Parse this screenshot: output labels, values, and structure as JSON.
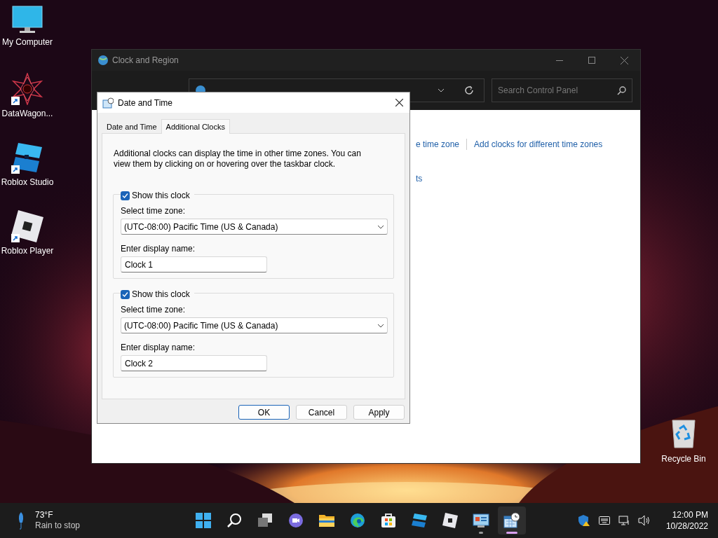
{
  "desktop_icons": [
    {
      "label": "My Computer",
      "kind": "monitor",
      "shortcut": false
    },
    {
      "label": "DataWagon...",
      "kind": "star",
      "shortcut": true
    },
    {
      "label": "Roblox Studio",
      "kind": "studio",
      "shortcut": true
    },
    {
      "label": "Roblox Player",
      "kind": "player",
      "shortcut": true
    }
  ],
  "recycle_bin": {
    "label": "Recycle Bin"
  },
  "control_panel": {
    "title": "Clock and Region",
    "search": {
      "placeholder": "Search Control Panel"
    },
    "links": [
      "e time zone",
      "Add clocks for different time zones"
    ],
    "link_2": "ts"
  },
  "dialog": {
    "title": "Date and Time",
    "tabs": [
      {
        "label": "Date and Time",
        "selected": false
      },
      {
        "label": "Additional Clocks",
        "selected": true
      }
    ],
    "description": "Additional clocks can display the time in other time zones. You can view them by clicking on or hovering over the taskbar clock.",
    "clocks": [
      {
        "checked": true,
        "checkbox_label": "Show this clock",
        "zone_label": "Select time zone:",
        "zone": "(UTC-08:00) Pacific Time (US & Canada)",
        "name_label": "Enter display name:",
        "name": "Clock 1"
      },
      {
        "checked": true,
        "checkbox_label": "Show this clock",
        "zone_label": "Select time zone:",
        "zone": "(UTC-08:00) Pacific Time (US & Canada)",
        "name_label": "Enter display name:",
        "name": "Clock 2"
      }
    ],
    "buttons": [
      {
        "label": "OK",
        "default": true
      },
      {
        "label": "Cancel",
        "default": false
      },
      {
        "label": "Apply",
        "default": false
      }
    ]
  },
  "taskbar": {
    "weather": {
      "temperature": "73°F",
      "condition": "Rain to stop"
    },
    "apps": [
      {
        "kind": "start",
        "running": false,
        "active": false
      },
      {
        "kind": "search",
        "running": false,
        "active": false
      },
      {
        "kind": "taskview",
        "running": false,
        "active": false
      },
      {
        "kind": "chat",
        "running": false,
        "active": false
      },
      {
        "kind": "explorer",
        "running": false,
        "active": false
      },
      {
        "kind": "edge",
        "running": false,
        "active": false
      },
      {
        "kind": "store",
        "running": false,
        "active": false
      },
      {
        "kind": "studio",
        "running": false,
        "active": false
      },
      {
        "kind": "player",
        "running": false,
        "active": false
      },
      {
        "kind": "controlpanel",
        "running": true,
        "active": false
      },
      {
        "kind": "datetime",
        "running": true,
        "active": true
      }
    ],
    "time": "12:00 PM",
    "date": "10/28/2022"
  }
}
